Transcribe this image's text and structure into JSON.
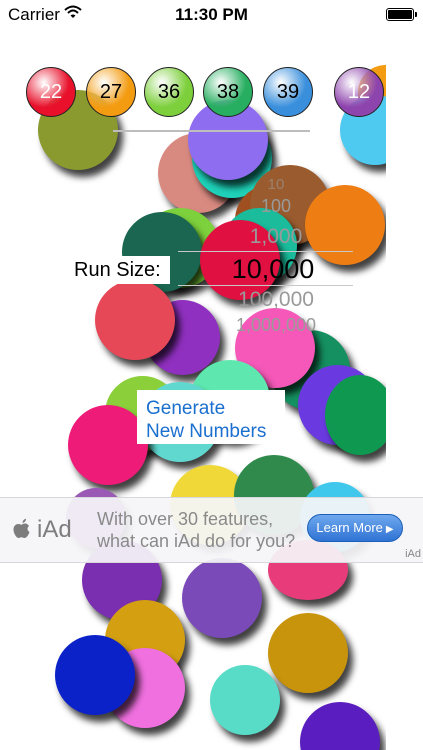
{
  "status_bar": {
    "carrier": "Carrier",
    "time": "11:30 PM",
    "battery_level": 1.0
  },
  "balls": [
    {
      "number": "22",
      "color": "#e8102a",
      "text_color": "#ffffff"
    },
    {
      "number": "27",
      "color": "#f39c12",
      "text_color": "#000000"
    },
    {
      "number": "36",
      "color": "#7dcf3c",
      "text_color": "#000000"
    },
    {
      "number": "38",
      "color": "#27ae60",
      "text_color": "#000000"
    },
    {
      "number": "39",
      "color": "#3a8fdc",
      "text_color": "#000000"
    },
    {
      "number": "12",
      "color": "#8e44ad",
      "text_color": "#ffffff"
    }
  ],
  "run_size": {
    "label": "Run Size:",
    "options": [
      "10",
      "100",
      "1,000",
      "10,000",
      "100,000",
      "1,000,000"
    ],
    "selected": "10,000"
  },
  "generate_button": {
    "line1": "Generate",
    "line2": "New Numbers"
  },
  "ad": {
    "logo_text": "iAd",
    "message_line1": "With over 30 features,",
    "message_line2": "what can iAd do for you?",
    "cta": "Learn More",
    "tag": "iAd"
  }
}
